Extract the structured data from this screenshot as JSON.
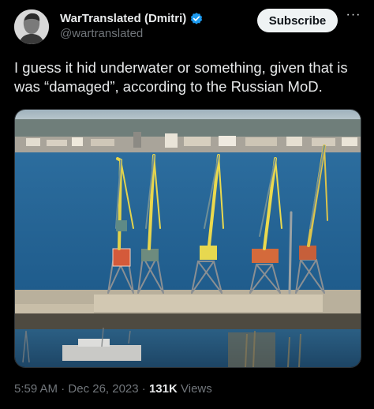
{
  "author": {
    "display_name": "WarTranslated (Dmitri)",
    "handle": "@wartranslated",
    "avatar_icon": "avatar-photo",
    "verified_icon": "verified-badge-icon",
    "verified_color": "#1d9bf0"
  },
  "actions": {
    "subscribe_label": "Subscribe",
    "more_icon": "more-options-icon",
    "more_glyph": "···"
  },
  "tweet": {
    "text": "I guess it hid underwater or something, given that is was “damaged”, according to the Russian MoD."
  },
  "media": {
    "icon": "harbor-photo",
    "description_icons": [
      "harbor-crane",
      "water",
      "shoreline-city"
    ]
  },
  "meta": {
    "time": "5:59 AM",
    "separator": "·",
    "date": "Dec 26, 2023",
    "views_count": "131K",
    "views_label": "Views"
  },
  "colors": {
    "background": "#000000",
    "text": "#e7e9ea",
    "muted": "#71767b",
    "button_bg": "#eff3f4",
    "button_text": "#0f1419"
  }
}
